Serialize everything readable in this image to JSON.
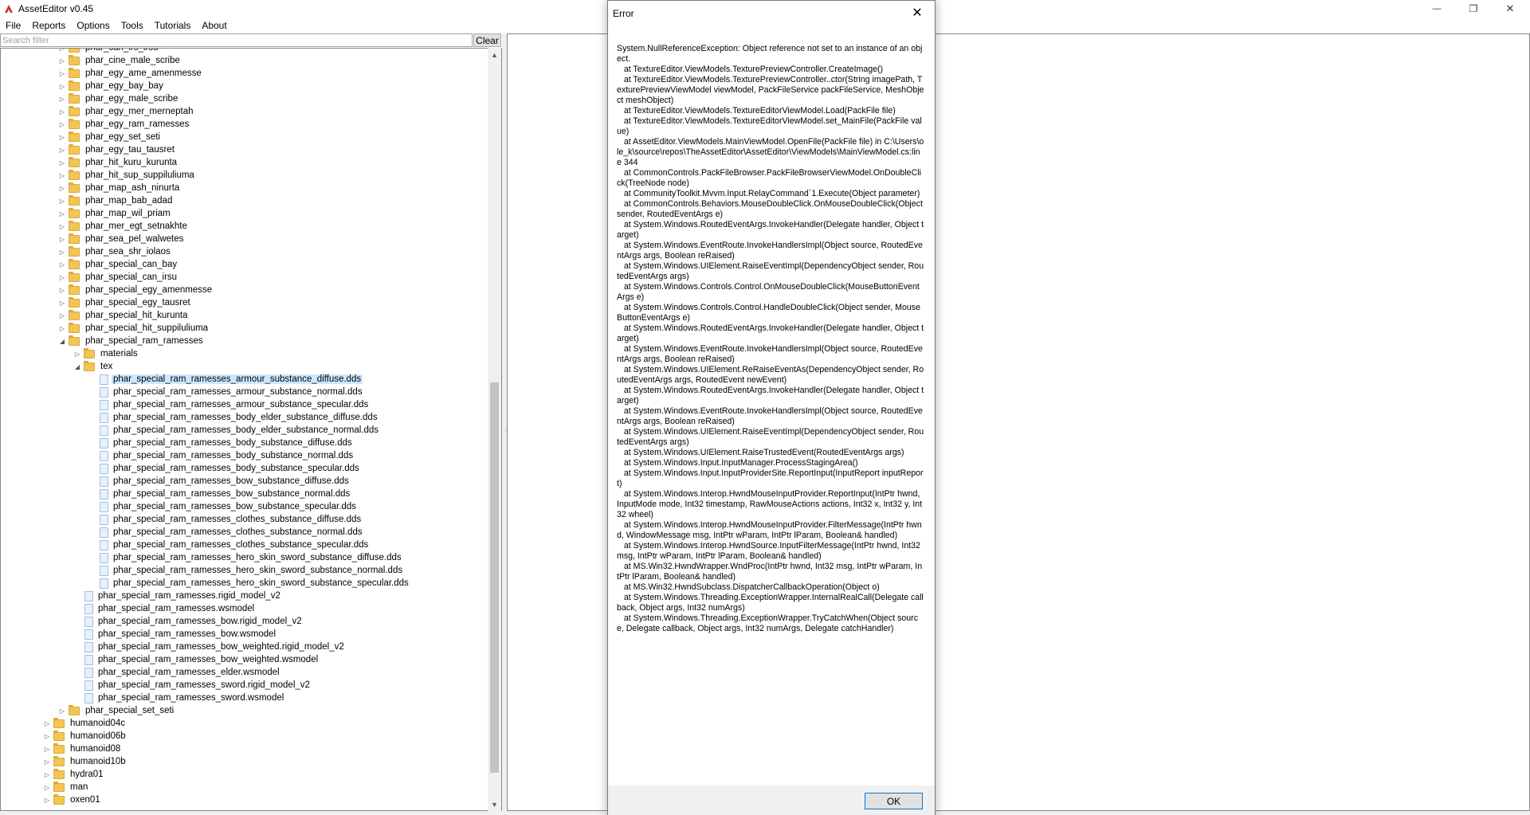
{
  "window": {
    "title": "AssetEditor v0.45",
    "minimize_glyph": "—",
    "restore_glyph": "❐",
    "close_glyph": "✕"
  },
  "menu": [
    "File",
    "Reports",
    "Options",
    "Tools",
    "Tutorials",
    "About"
  ],
  "filter": {
    "placeholder": "Search filter",
    "value": "",
    "clear_label": "Clear"
  },
  "tree": [
    {
      "label": "phar_can_irs_irsu",
      "level": 2,
      "type": "folder",
      "expander": "collapsed"
    },
    {
      "label": "phar_cine_male_scribe",
      "level": 2,
      "type": "folder",
      "expander": "collapsed"
    },
    {
      "label": "phar_egy_ame_amenmesse",
      "level": 2,
      "type": "folder",
      "expander": "collapsed"
    },
    {
      "label": "phar_egy_bay_bay",
      "level": 2,
      "type": "folder",
      "expander": "collapsed"
    },
    {
      "label": "phar_egy_male_scribe",
      "level": 2,
      "type": "folder",
      "expander": "collapsed"
    },
    {
      "label": "phar_egy_mer_merneptah",
      "level": 2,
      "type": "folder",
      "expander": "collapsed"
    },
    {
      "label": "phar_egy_ram_ramesses",
      "level": 2,
      "type": "folder",
      "expander": "collapsed"
    },
    {
      "label": "phar_egy_set_seti",
      "level": 2,
      "type": "folder",
      "expander": "collapsed"
    },
    {
      "label": "phar_egy_tau_tausret",
      "level": 2,
      "type": "folder",
      "expander": "collapsed"
    },
    {
      "label": "phar_hit_kuru_kurunta",
      "level": 2,
      "type": "folder",
      "expander": "collapsed"
    },
    {
      "label": "phar_hit_sup_suppiluliuma",
      "level": 2,
      "type": "folder",
      "expander": "collapsed"
    },
    {
      "label": "phar_map_ash_ninurta",
      "level": 2,
      "type": "folder",
      "expander": "collapsed"
    },
    {
      "label": "phar_map_bab_adad",
      "level": 2,
      "type": "folder",
      "expander": "collapsed"
    },
    {
      "label": "phar_map_wil_priam",
      "level": 2,
      "type": "folder",
      "expander": "collapsed"
    },
    {
      "label": "phar_mer_egt_setnakhte",
      "level": 2,
      "type": "folder",
      "expander": "collapsed"
    },
    {
      "label": "phar_sea_pel_walwetes",
      "level": 2,
      "type": "folder",
      "expander": "collapsed"
    },
    {
      "label": "phar_sea_shr_iolaos",
      "level": 2,
      "type": "folder",
      "expander": "collapsed"
    },
    {
      "label": "phar_special_can_bay",
      "level": 2,
      "type": "folder",
      "expander": "collapsed"
    },
    {
      "label": "phar_special_can_irsu",
      "level": 2,
      "type": "folder",
      "expander": "collapsed"
    },
    {
      "label": "phar_special_egy_amenmesse",
      "level": 2,
      "type": "folder",
      "expander": "collapsed"
    },
    {
      "label": "phar_special_egy_tausret",
      "level": 2,
      "type": "folder",
      "expander": "collapsed"
    },
    {
      "label": "phar_special_hit_kurunta",
      "level": 2,
      "type": "folder",
      "expander": "collapsed"
    },
    {
      "label": "phar_special_hit_suppiluliuma",
      "level": 2,
      "type": "folder",
      "expander": "collapsed"
    },
    {
      "label": "phar_special_ram_ramesses",
      "level": 2,
      "type": "folder",
      "expander": "expanded"
    },
    {
      "label": "materials",
      "level": 3,
      "type": "folder",
      "expander": "collapsed"
    },
    {
      "label": "tex",
      "level": 3,
      "type": "folder",
      "expander": "expanded"
    },
    {
      "label": "phar_special_ram_ramesses_armour_substance_diffuse.dds",
      "level": 4,
      "type": "file",
      "selected": true
    },
    {
      "label": "phar_special_ram_ramesses_armour_substance_normal.dds",
      "level": 4,
      "type": "file"
    },
    {
      "label": "phar_special_ram_ramesses_armour_substance_specular.dds",
      "level": 4,
      "type": "file"
    },
    {
      "label": "phar_special_ram_ramesses_body_elder_substance_diffuse.dds",
      "level": 4,
      "type": "file"
    },
    {
      "label": "phar_special_ram_ramesses_body_elder_substance_normal.dds",
      "level": 4,
      "type": "file"
    },
    {
      "label": "phar_special_ram_ramesses_body_substance_diffuse.dds",
      "level": 4,
      "type": "file"
    },
    {
      "label": "phar_special_ram_ramesses_body_substance_normal.dds",
      "level": 4,
      "type": "file"
    },
    {
      "label": "phar_special_ram_ramesses_body_substance_specular.dds",
      "level": 4,
      "type": "file"
    },
    {
      "label": "phar_special_ram_ramesses_bow_substance_diffuse.dds",
      "level": 4,
      "type": "file"
    },
    {
      "label": "phar_special_ram_ramesses_bow_substance_normal.dds",
      "level": 4,
      "type": "file"
    },
    {
      "label": "phar_special_ram_ramesses_bow_substance_specular.dds",
      "level": 4,
      "type": "file"
    },
    {
      "label": "phar_special_ram_ramesses_clothes_substance_diffuse.dds",
      "level": 4,
      "type": "file"
    },
    {
      "label": "phar_special_ram_ramesses_clothes_substance_normal.dds",
      "level": 4,
      "type": "file"
    },
    {
      "label": "phar_special_ram_ramesses_clothes_substance_specular.dds",
      "level": 4,
      "type": "file"
    },
    {
      "label": "phar_special_ram_ramesses_hero_skin_sword_substance_diffuse.dds",
      "level": 4,
      "type": "file"
    },
    {
      "label": "phar_special_ram_ramesses_hero_skin_sword_substance_normal.dds",
      "level": 4,
      "type": "file"
    },
    {
      "label": "phar_special_ram_ramesses_hero_skin_sword_substance_specular.dds",
      "level": 4,
      "type": "file"
    },
    {
      "label": "phar_special_ram_ramesses.rigid_model_v2",
      "level": 3,
      "type": "file"
    },
    {
      "label": "phar_special_ram_ramesses.wsmodel",
      "level": 3,
      "type": "file"
    },
    {
      "label": "phar_special_ram_ramesses_bow.rigid_model_v2",
      "level": 3,
      "type": "file"
    },
    {
      "label": "phar_special_ram_ramesses_bow.wsmodel",
      "level": 3,
      "type": "file"
    },
    {
      "label": "phar_special_ram_ramesses_bow_weighted.rigid_model_v2",
      "level": 3,
      "type": "file"
    },
    {
      "label": "phar_special_ram_ramesses_bow_weighted.wsmodel",
      "level": 3,
      "type": "file"
    },
    {
      "label": "phar_special_ram_ramesses_elder.wsmodel",
      "level": 3,
      "type": "file"
    },
    {
      "label": "phar_special_ram_ramesses_sword.rigid_model_v2",
      "level": 3,
      "type": "file"
    },
    {
      "label": "phar_special_ram_ramesses_sword.wsmodel",
      "level": 3,
      "type": "file"
    },
    {
      "label": "phar_special_set_seti",
      "level": 2,
      "type": "folder",
      "expander": "collapsed"
    },
    {
      "label": "humanoid04c",
      "level": 1,
      "type": "folder",
      "expander": "collapsed"
    },
    {
      "label": "humanoid06b",
      "level": 1,
      "type": "folder",
      "expander": "collapsed"
    },
    {
      "label": "humanoid08",
      "level": 1,
      "type": "folder",
      "expander": "collapsed"
    },
    {
      "label": "humanoid10b",
      "level": 1,
      "type": "folder",
      "expander": "collapsed"
    },
    {
      "label": "hydra01",
      "level": 1,
      "type": "folder",
      "expander": "collapsed"
    },
    {
      "label": "man",
      "level": 1,
      "type": "folder",
      "expander": "collapsed"
    },
    {
      "label": "oxen01",
      "level": 1,
      "type": "folder",
      "expander": "collapsed"
    }
  ],
  "dialog": {
    "title": "Error",
    "close_glyph": "✕",
    "message": "System.NullReferenceException: Object reference not set to an instance of an object.\n   at TextureEditor.ViewModels.TexturePreviewController.CreateImage()\n   at TextureEditor.ViewModels.TexturePreviewController..ctor(String imagePath, TexturePreviewViewModel viewModel, PackFileService packFileService, MeshObject meshObject)\n   at TextureEditor.ViewModels.TextureEditorViewModel.Load(PackFile file)\n   at TextureEditor.ViewModels.TextureEditorViewModel.set_MainFile(PackFile value)\n   at AssetEditor.ViewModels.MainViewModel.OpenFile(PackFile file) in C:\\Users\\ole_k\\source\\repos\\TheAssetEditor\\AssetEditor\\ViewModels\\MainViewModel.cs:line 344\n   at CommonControls.PackFileBrowser.PackFileBrowserViewModel.OnDoubleClick(TreeNode node)\n   at CommunityToolkit.Mvvm.Input.RelayCommand`1.Execute(Object parameter)\n   at CommonControls.Behaviors.MouseDoubleClick.OnMouseDoubleClick(Object sender, RoutedEventArgs e)\n   at System.Windows.RoutedEventArgs.InvokeHandler(Delegate handler, Object target)\n   at System.Windows.EventRoute.InvokeHandlersImpl(Object source, RoutedEventArgs args, Boolean reRaised)\n   at System.Windows.UIElement.RaiseEventImpl(DependencyObject sender, RoutedEventArgs args)\n   at System.Windows.Controls.Control.OnMouseDoubleClick(MouseButtonEventArgs e)\n   at System.Windows.Controls.Control.HandleDoubleClick(Object sender, MouseButtonEventArgs e)\n   at System.Windows.RoutedEventArgs.InvokeHandler(Delegate handler, Object target)\n   at System.Windows.EventRoute.InvokeHandlersImpl(Object source, RoutedEventArgs args, Boolean reRaised)\n   at System.Windows.UIElement.ReRaiseEventAs(DependencyObject sender, RoutedEventArgs args, RoutedEvent newEvent)\n   at System.Windows.RoutedEventArgs.InvokeHandler(Delegate handler, Object target)\n   at System.Windows.EventRoute.InvokeHandlersImpl(Object source, RoutedEventArgs args, Boolean reRaised)\n   at System.Windows.UIElement.RaiseEventImpl(DependencyObject sender, RoutedEventArgs args)\n   at System.Windows.UIElement.RaiseTrustedEvent(RoutedEventArgs args)\n   at System.Windows.Input.InputManager.ProcessStagingArea()\n   at System.Windows.Input.InputProviderSite.ReportInput(InputReport inputReport)\n   at System.Windows.Interop.HwndMouseInputProvider.ReportInput(IntPtr hwnd, InputMode mode, Int32 timestamp, RawMouseActions actions, Int32 x, Int32 y, Int32 wheel)\n   at System.Windows.Interop.HwndMouseInputProvider.FilterMessage(IntPtr hwnd, WindowMessage msg, IntPtr wParam, IntPtr lParam, Boolean& handled)\n   at System.Windows.Interop.HwndSource.InputFilterMessage(IntPtr hwnd, Int32 msg, IntPtr wParam, IntPtr lParam, Boolean& handled)\n   at MS.Win32.HwndWrapper.WndProc(IntPtr hwnd, Int32 msg, IntPtr wParam, IntPtr lParam, Boolean& handled)\n   at MS.Win32.HwndSubclass.DispatcherCallbackOperation(Object o)\n   at System.Windows.Threading.ExceptionWrapper.InternalRealCall(Delegate callback, Object args, Int32 numArgs)\n   at System.Windows.Threading.ExceptionWrapper.TryCatchWhen(Object source, Delegate callback, Object args, Int32 numArgs, Delegate catchHandler)",
    "ok_label": "OK"
  },
  "colors": {
    "selection": "#cce8ff",
    "folder": "#f2c555",
    "accent": "#0078d7",
    "app_icon": "#c0392b"
  }
}
